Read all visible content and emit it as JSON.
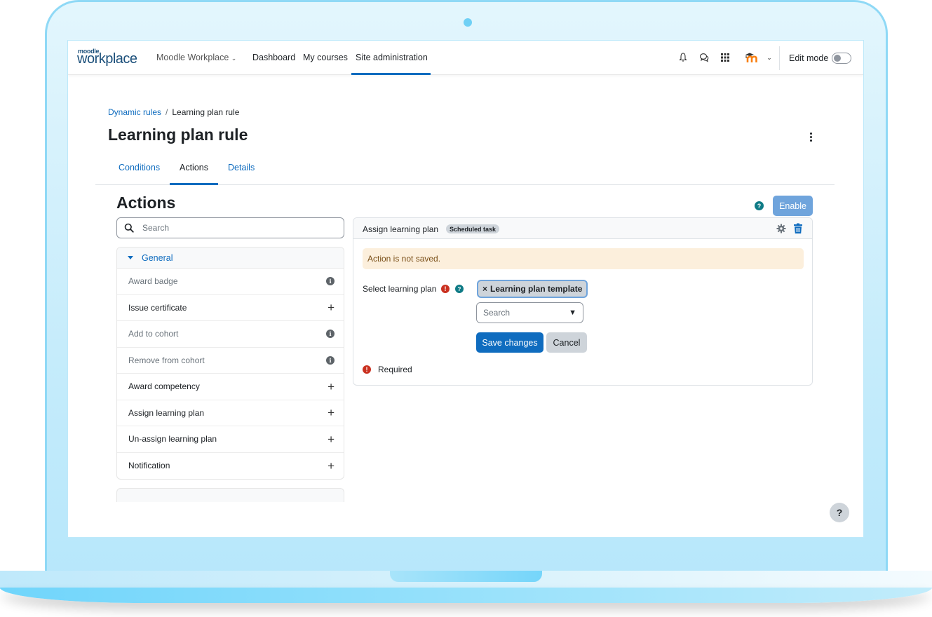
{
  "navbar": {
    "logo_small": "moodle",
    "logo_big": "workplace",
    "brand_menu": "Moodle Workplace",
    "items": [
      {
        "label": "Dashboard"
      },
      {
        "label": "My courses"
      },
      {
        "label": "Site administration",
        "active": true
      }
    ],
    "icons": [
      "bell-icon",
      "messages-icon",
      "apps-grid-icon",
      "user-avatar-icon"
    ],
    "edit_mode_label": "Edit mode",
    "edit_mode_on": false
  },
  "breadcrumb": {
    "parent": "Dynamic rules",
    "separator": "/",
    "current": "Learning plan rule"
  },
  "page_title": "Learning plan rule",
  "tabs": [
    {
      "label": "Conditions",
      "active": false
    },
    {
      "label": "Actions",
      "active": true
    },
    {
      "label": "Details",
      "active": false
    }
  ],
  "section": {
    "title": "Actions",
    "help_glyph": "?",
    "enable_label": "Enable"
  },
  "left_panel": {
    "search_placeholder": "Search",
    "group_label": "General",
    "items": [
      {
        "label": "Award badge",
        "icon": "info",
        "disabled": true
      },
      {
        "label": "Issue certificate",
        "icon": "plus",
        "disabled": false
      },
      {
        "label": "Add to cohort",
        "icon": "info",
        "disabled": true
      },
      {
        "label": "Remove from cohort",
        "icon": "info",
        "disabled": true
      },
      {
        "label": "Award competency",
        "icon": "plus",
        "disabled": false
      },
      {
        "label": "Assign learning plan",
        "icon": "plus",
        "disabled": false
      },
      {
        "label": "Un-assign learning plan",
        "icon": "plus",
        "disabled": false
      },
      {
        "label": "Notification",
        "icon": "plus",
        "disabled": false
      }
    ]
  },
  "action_card": {
    "title": "Assign learning plan",
    "badge": "Scheduled task",
    "alert": "Action is not saved.",
    "field_label": "Select learning plan",
    "selected_chip": "Learning plan template",
    "chip_remove": "×",
    "select_placeholder": "Search",
    "select_arrow": "▼",
    "save_label": "Save changes",
    "cancel_label": "Cancel",
    "required_label": "Required",
    "required_glyph": "!"
  },
  "help_float_glyph": "?",
  "colors": {
    "primary": "#0f6cbf",
    "enable_disabled": "#6fa4dc",
    "danger": "#ca3120",
    "help_teal": "#0f7b86",
    "alert_bg": "#fcefdc",
    "moodle_orange": "#f98012"
  }
}
